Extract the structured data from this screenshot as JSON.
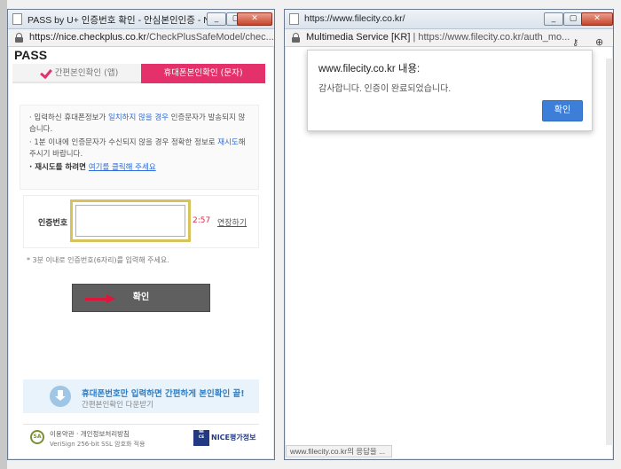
{
  "left_window": {
    "title": "PASS by U+ 인증번호 확인 - 안심본인인증 - NICE...",
    "url_host": "https://nice.checkplus.co.kr",
    "url_path": "/CheckPlusSafeModel/chec...",
    "logo": "PASS",
    "tabs": [
      {
        "label": "간편본인확인 (앱)"
      },
      {
        "label": "휴대폰본인확인 (문자)"
      }
    ],
    "notice": {
      "line1_pre": "· 입력하신 휴대폰정보가 ",
      "line1_hl": "일치하지 않을 경우",
      "line1_post": " 인증문자가 발송되지 않습니다.",
      "line2_pre": "· 1분 이내에 인증문자가 수신되지 않을 경우 정확한 정보로 ",
      "line2_hl": "재시도",
      "line2_post": "해 주시기 바랍니다.",
      "line3_strong": "· 재시도를 하려면 ",
      "line3_link": "여기를 클릭해 주세요"
    },
    "auth_label": "인증번호",
    "auth_value": "",
    "timer": "2:57",
    "extend_label": "연장하기",
    "hint": "* 3분 이내로 인증번호(6자리)를 입력해 주세요.",
    "confirm_label": "확인",
    "promo_title": "휴대폰번호만 입력하면 간편하게 본인확인 끝!",
    "promo_sub": "간편본인확인 다운받기",
    "footer_line1": "이용약관 · 개인정보처리방침",
    "footer_line2": "VeriSign 256-bit SSL 암호화 적용",
    "nice_text": "NICE평가정보"
  },
  "right_window": {
    "title": "https://www.filecity.co.kr/",
    "url_org": "Multimedia Service [KR]",
    "url_sep": "|",
    "url": "https://www.filecity.co.kr/auth_mo...",
    "dialog": {
      "title": "www.filecity.co.kr 내용:",
      "message": "감사합니다. 인증이 완료되었습니다.",
      "ok_label": "확인"
    },
    "status": "www.filecity.co.kr의 응답을 ..."
  },
  "icons": {
    "minimize": "minimize-icon",
    "maximize": "maximize-icon",
    "close": "close-icon",
    "lock": "lock-icon",
    "key": "key-icon",
    "zoom": "zoom-icon",
    "check": "check-icon",
    "download": "download-icon",
    "arrow": "arrow-right-icon"
  },
  "colors": {
    "pass_pink": "#e4316b",
    "highlight_yellow": "#d8c35a",
    "dialog_button": "#3d7ed9",
    "nice_blue": "#233a83"
  }
}
